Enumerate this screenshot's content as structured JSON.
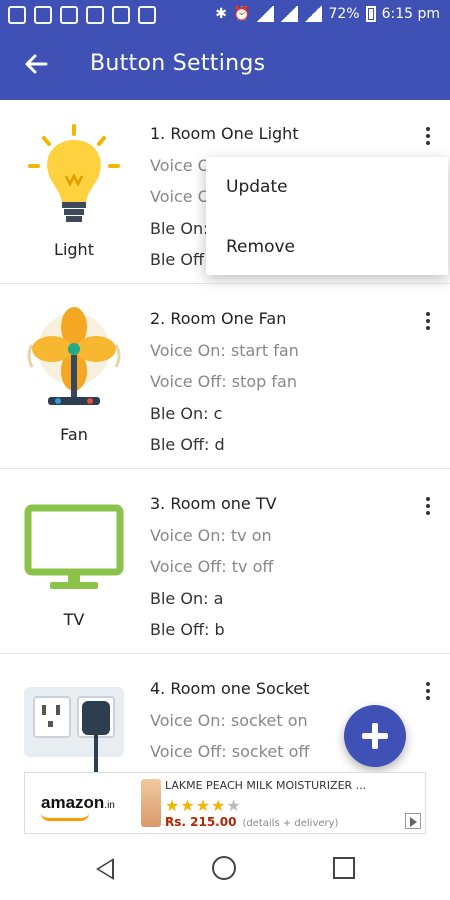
{
  "status_bar": {
    "battery": "72%",
    "time": "6:15 pm"
  },
  "toolbar": {
    "title": "Button Settings"
  },
  "buttons": [
    {
      "icon": "light-bulb-icon",
      "icon_label": "Light",
      "title": "1. Room One Light",
      "voice_on": "Voice O",
      "voice_off": "Voice O",
      "ble_on": "Ble On:",
      "ble_off": "Ble Off"
    },
    {
      "icon": "fan-icon",
      "icon_label": "Fan",
      "title": "2. Room One Fan",
      "voice_on": "Voice On: start fan",
      "voice_off": "Voice Off: stop fan",
      "ble_on": "Ble On: c",
      "ble_off": "Ble Off: d"
    },
    {
      "icon": "tv-icon",
      "icon_label": "TV",
      "title": "3. Room one TV",
      "voice_on": "Voice On: tv on",
      "voice_off": "Voice Off: tv off",
      "ble_on": "Ble On: a",
      "ble_off": "Ble Off: b"
    },
    {
      "icon": "socket-icon",
      "icon_label": "",
      "title": "4. Room one Socket",
      "voice_on": "Voice On: socket on",
      "voice_off": "Voice Off: socket off"
    }
  ],
  "popup_menu": {
    "items": [
      "Update",
      "Remove"
    ]
  },
  "ad": {
    "brand": "amazon",
    "brand_tld": ".in",
    "product_title": "LAKME PEACH MILK MOISTURIZER ...",
    "stars_filled": "★★★★",
    "stars_empty": "★",
    "price": "Rs. 215.00",
    "delivery": "(details + delivery)"
  },
  "colors": {
    "primary": "#3f51b5",
    "fab": "#3f51b5",
    "tv_green": "#8bc34a"
  }
}
